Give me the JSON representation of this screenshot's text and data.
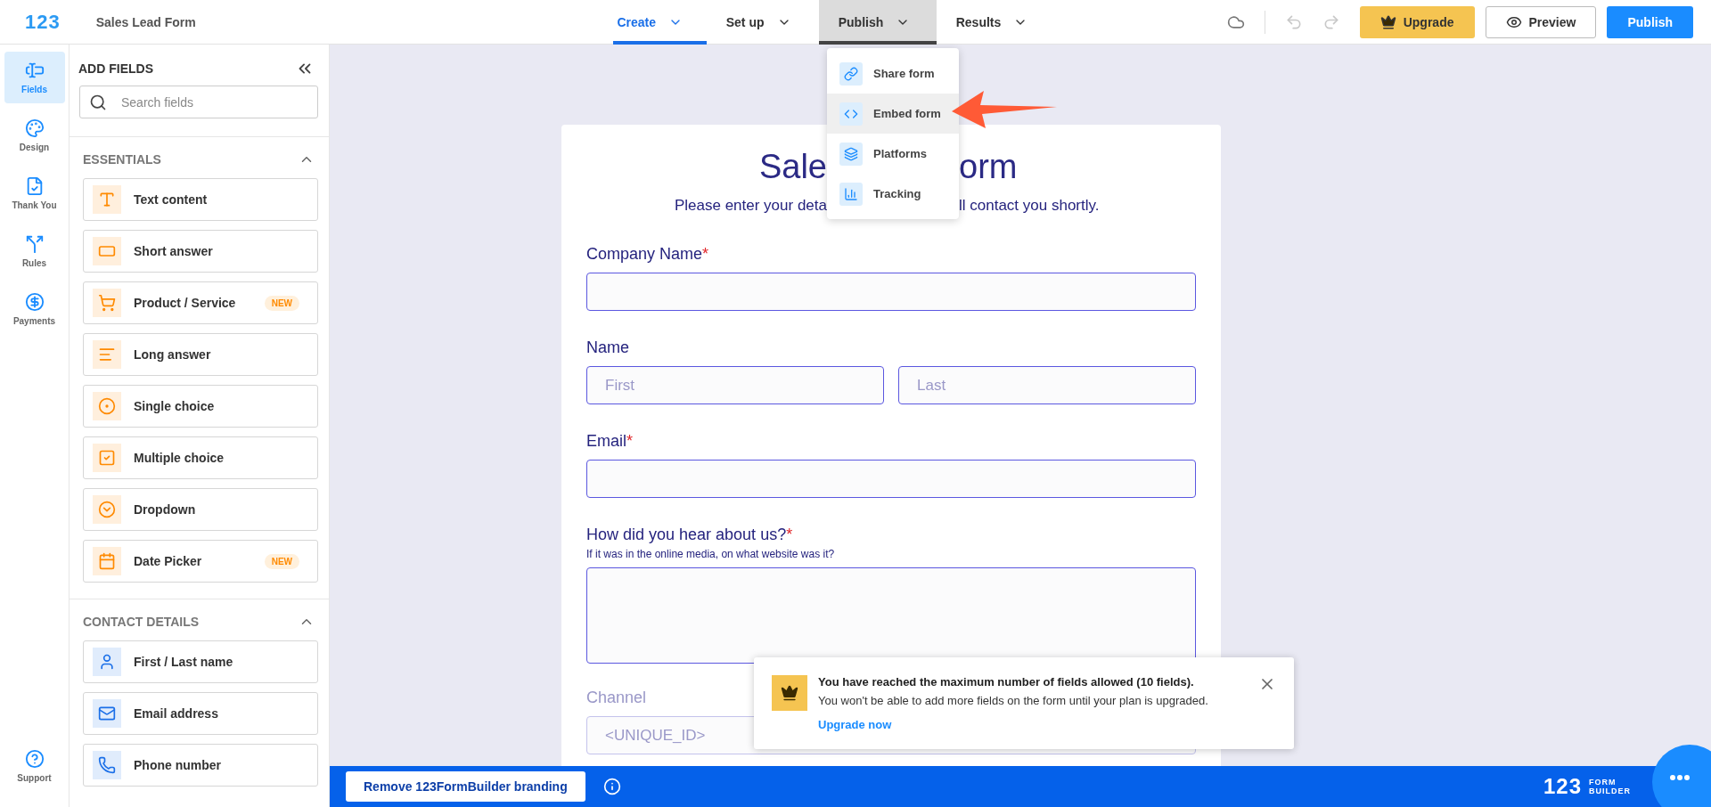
{
  "header": {
    "logo": "123",
    "title": "Sales Lead Form",
    "nav": [
      {
        "label": "Create",
        "selected": true,
        "expanded": false
      },
      {
        "label": "Set up",
        "selected": false,
        "expanded": false
      },
      {
        "label": "Publish",
        "selected": false,
        "expanded": true
      },
      {
        "label": "Results",
        "selected": false,
        "expanded": false
      }
    ],
    "upgrade": "Upgrade",
    "preview": "Preview",
    "publish": "Publish"
  },
  "rail": {
    "items": [
      {
        "label": "Fields",
        "kind": "fields",
        "selected": true
      },
      {
        "label": "Design",
        "kind": "design",
        "selected": false
      },
      {
        "label": "Thank You",
        "kind": "thankyou",
        "selected": false
      },
      {
        "label": "Rules",
        "kind": "rules",
        "selected": false
      },
      {
        "label": "Payments",
        "kind": "payments",
        "selected": false
      }
    ],
    "support": "Support"
  },
  "panel": {
    "title": "ADD FIELDS",
    "search": {
      "placeholder": "Search fields"
    },
    "sections": [
      {
        "title": "ESSENTIALS",
        "expanded": true,
        "color": "#ff8a00",
        "items": [
          {
            "label": "Text content",
            "kind": "text"
          },
          {
            "label": "Short answer",
            "kind": "short"
          },
          {
            "label": "Product / Service",
            "kind": "product",
            "badge": "NEW"
          },
          {
            "label": "Long answer",
            "kind": "long"
          },
          {
            "label": "Single choice",
            "kind": "single"
          },
          {
            "label": "Multiple choice",
            "kind": "multiple"
          },
          {
            "label": "Dropdown",
            "kind": "dropdown"
          },
          {
            "label": "Date Picker",
            "kind": "date",
            "badge": "NEW"
          }
        ]
      },
      {
        "title": "CONTACT DETAILS",
        "expanded": true,
        "color": "#1a6fe8",
        "items": [
          {
            "label": "First / Last name",
            "kind": "name"
          },
          {
            "label": "Email address",
            "kind": "email"
          },
          {
            "label": "Phone number",
            "kind": "phone"
          }
        ]
      }
    ]
  },
  "publish_menu": {
    "items": [
      {
        "label": "Share form",
        "kind": "share",
        "selected": false
      },
      {
        "label": "Embed form",
        "kind": "embed",
        "selected": true
      },
      {
        "label": "Platforms",
        "kind": "platforms",
        "selected": false
      },
      {
        "label": "Tracking",
        "kind": "tracking",
        "selected": false
      }
    ]
  },
  "form": {
    "title": [
      "Sale",
      "orm"
    ],
    "subtitle": [
      "Please enter your deta",
      "ll contact you shortly."
    ],
    "fields": [
      {
        "kind": "text",
        "label": "Company Name",
        "required_mark": "*"
      },
      {
        "kind": "name",
        "label": "Name",
        "placeholders": [
          "First",
          "Last"
        ]
      },
      {
        "kind": "text",
        "label": "Email",
        "required_mark": "*"
      },
      {
        "kind": "textarea",
        "label": "How did you hear about us?",
        "required_mark": "*",
        "hint": "If it was in the online media, on what website was it?"
      },
      {
        "kind": "text",
        "label": "Channel",
        "disabled": true,
        "value": "<UNIQUE_ID>"
      }
    ]
  },
  "notification": {
    "title": "You have reached the maximum number of fields allowed (10 fields).",
    "message": "You won't be able to add more fields on the form until your plan is upgraded.",
    "link": "Upgrade now"
  },
  "footer": {
    "button": "Remove 123FormBuilder branding",
    "logo": "123",
    "logo_words": [
      "FORM",
      "BUILDER"
    ]
  }
}
